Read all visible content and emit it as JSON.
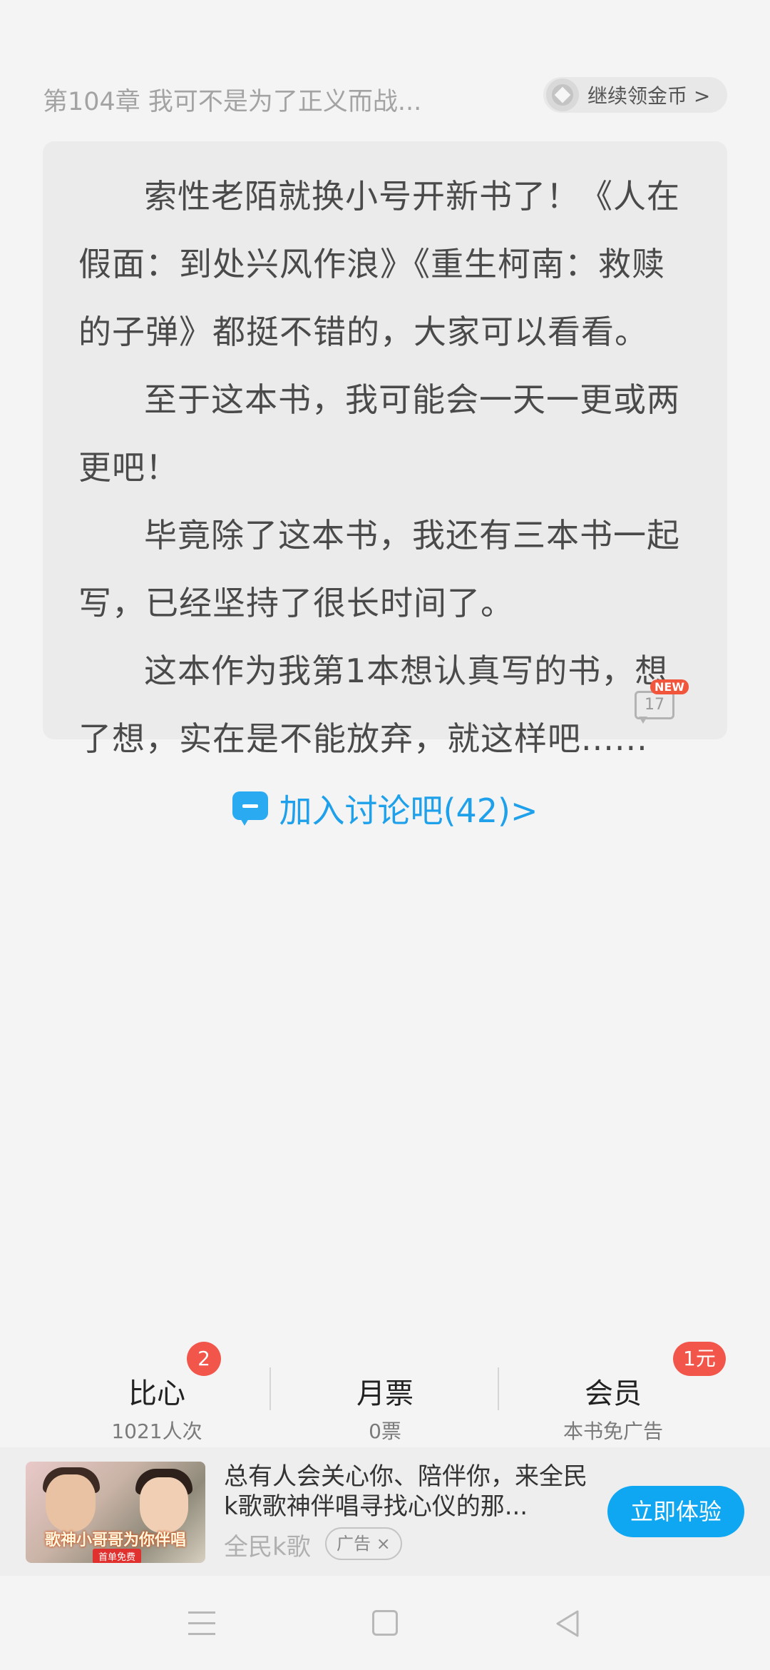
{
  "header": {
    "chapter_title": "第104章 我可不是为了正义而战...",
    "coin_button_label": "继续领金币 >"
  },
  "author_note": {
    "paragraphs": [
      "索性老陌就换小号开新书了！《人在假面：到处兴风作浪》《重生柯南：救赎的子弹》都挺不错的，大家可以看看。",
      "至于这本书，我可能会一天一更或两更吧！",
      "毕竟除了这本书，我还有三本书一起写，已经坚持了很长时间了。",
      "这本作为我第1本想认真写的书，想了想，实在是不能放弃，就这样吧......"
    ],
    "comment_count": "17",
    "new_tag": "NEW"
  },
  "discussion": {
    "label": "加入讨论吧(42)>"
  },
  "stats": {
    "bixin": {
      "label": "比心",
      "sub": "1021人次",
      "badge": "2"
    },
    "yuepiao": {
      "label": "月票",
      "sub": "0票"
    },
    "member": {
      "label": "会员",
      "sub": "本书免广告",
      "badge": "1元"
    }
  },
  "ad": {
    "thumb_caption": "歌神小哥哥为你伴唱",
    "thumb_sub": "首单免费",
    "description": "总有人会关心你、陪伴你，来全民k歌歌神伴唱寻找心仪的那...",
    "source": "全民k歌",
    "tag": "广告 ×",
    "cta": "立即体验"
  },
  "colors": {
    "accent_blue": "#1ea0ea",
    "badge_red": "#f2554a",
    "cta_blue": "#10a7f2"
  }
}
